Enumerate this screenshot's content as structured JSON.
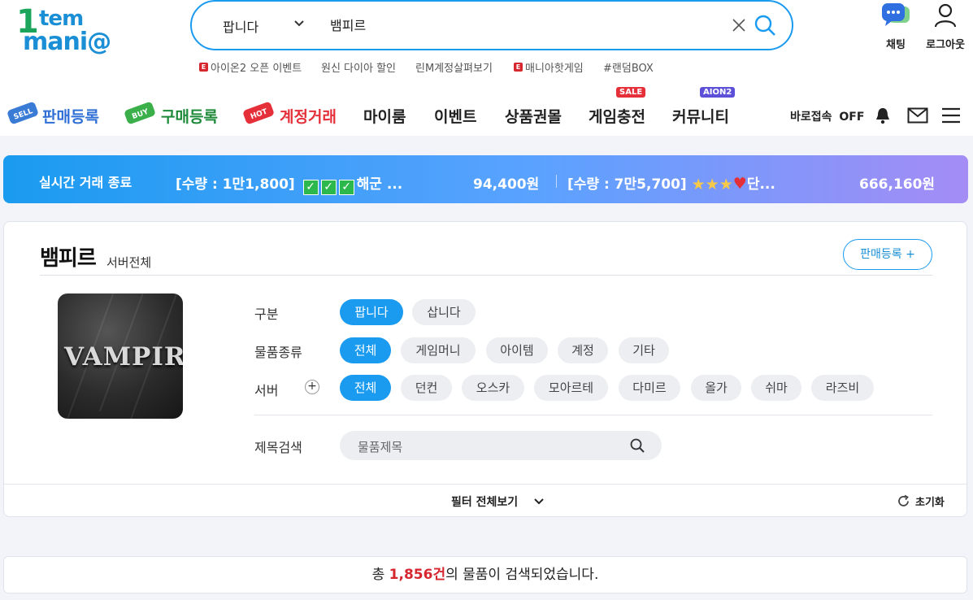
{
  "header": {
    "logo": {
      "part1": "1",
      "part2": "tem",
      "part3": "mani@"
    },
    "search": {
      "category": "팝니다",
      "query": "뱀피르"
    },
    "quick_links": [
      {
        "label": "아이온2 오픈 이벤트",
        "badge": "E"
      },
      {
        "label": "원신 다이아 할인",
        "badge": ""
      },
      {
        "label": "린M계정살펴보기",
        "badge": ""
      },
      {
        "label": "매니아핫게임",
        "badge": "E"
      },
      {
        "label": "#랜덤BOX",
        "badge": ""
      }
    ],
    "chat_label": "채팅",
    "logout_label": "로그아웃"
  },
  "nav": {
    "sell": "판매등록",
    "sell_badge": "SELL",
    "buy": "구매등록",
    "buy_badge": "BUY",
    "account": "계정거래",
    "account_badge": "HOT",
    "myroom": "마이룸",
    "event": "이벤트",
    "voucher": "상품권몰",
    "charge": "게임충전",
    "charge_tag": "SALE",
    "community": "커뮤니티",
    "community_tag": "AION2",
    "direct": "바로접속",
    "direct_state": "OFF"
  },
  "live": {
    "title": "실시간 거래 종료",
    "item1": {
      "text": "[수량 : 1만1,800]",
      "suffix": "해군 ...",
      "price": "94,400원"
    },
    "item2": {
      "text": "[수량 : 7만5,700]",
      "suffix": "단...",
      "price": "666,160원"
    }
  },
  "filter": {
    "title": "뱀피르",
    "subtitle": "서버전체",
    "sell_button": "판매등록 +",
    "game_logo_text": "VAMPIR",
    "type_label": "구분",
    "types": [
      "팝니다",
      "삽니다"
    ],
    "kind_label": "물품종류",
    "kinds": [
      "전체",
      "게임머니",
      "아이템",
      "계정",
      "기타"
    ],
    "server_label": "서버",
    "servers": [
      "전체",
      "던컨",
      "오스카",
      "모아르테",
      "다미르",
      "올가",
      "쉬마",
      "라즈비"
    ],
    "title_search_label": "제목검색",
    "title_search_placeholder": "물품제목",
    "view_all": "필터 전체보기",
    "reset": "초기화"
  },
  "result": {
    "prefix": "총 ",
    "count": "1,856건",
    "suffix": "의 물품이 검색되었습니다."
  },
  "colors": {
    "accent": "#1a9bf0",
    "green": "#1aa55b",
    "red": "#d6262e"
  }
}
